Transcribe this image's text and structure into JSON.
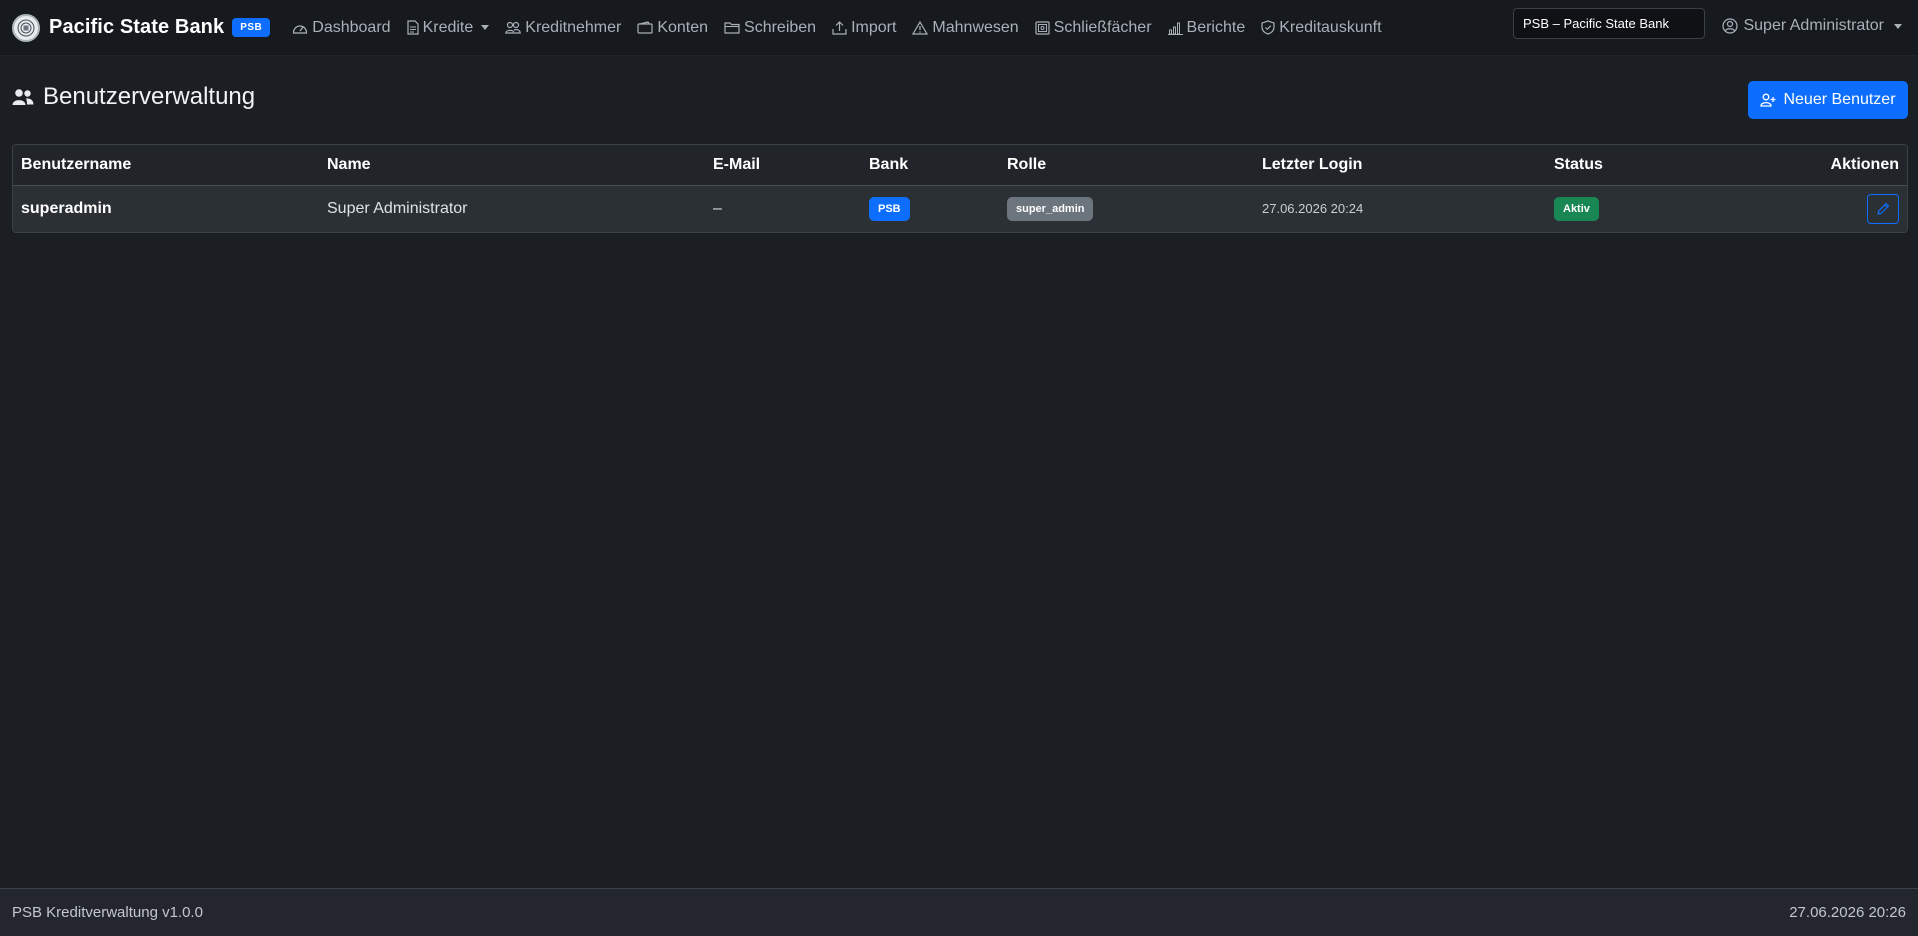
{
  "navbar": {
    "brand_name": "Pacific State Bank",
    "brand_badge": "PSB",
    "items": [
      {
        "label": "Dashboard",
        "icon": "speedometer-icon"
      },
      {
        "label": "Kredite",
        "icon": "document-icon",
        "dropdown": true
      },
      {
        "label": "Kreditnehmer",
        "icon": "people-icon"
      },
      {
        "label": "Konten",
        "icon": "wallet-icon"
      },
      {
        "label": "Schreiben",
        "icon": "folder-icon"
      },
      {
        "label": "Import",
        "icon": "upload-icon"
      },
      {
        "label": "Mahnwesen",
        "icon": "warning-icon"
      },
      {
        "label": "Schließfächer",
        "icon": "safe-icon"
      },
      {
        "label": "Berichte",
        "icon": "bar-chart-icon"
      },
      {
        "label": "Kreditauskunft",
        "icon": "shield-icon"
      }
    ],
    "bank_select_value": "PSB – Pacific State Bank",
    "user_label": "Super Administrator"
  },
  "page": {
    "title": "Benutzerverwaltung",
    "new_button_label": "Neuer Benutzer"
  },
  "table": {
    "headers": [
      "Benutzername",
      "Name",
      "E-Mail",
      "Bank",
      "Rolle",
      "Letzter Login",
      "Status",
      "Aktionen"
    ],
    "rows": [
      {
        "username": "superadmin",
        "name": "Super Administrator",
        "email": "–",
        "bank": "PSB",
        "role": "super_admin",
        "last_login": "27.06.2026 20:24",
        "status": "Aktiv"
      }
    ]
  },
  "footer": {
    "left": "PSB Kreditverwaltung v1.0.0",
    "right": "27.06.2026 20:26"
  },
  "colors": {
    "primary": "#0d6efd",
    "success": "#198754",
    "secondary": "#6c757d",
    "background": "#1b1e23"
  }
}
